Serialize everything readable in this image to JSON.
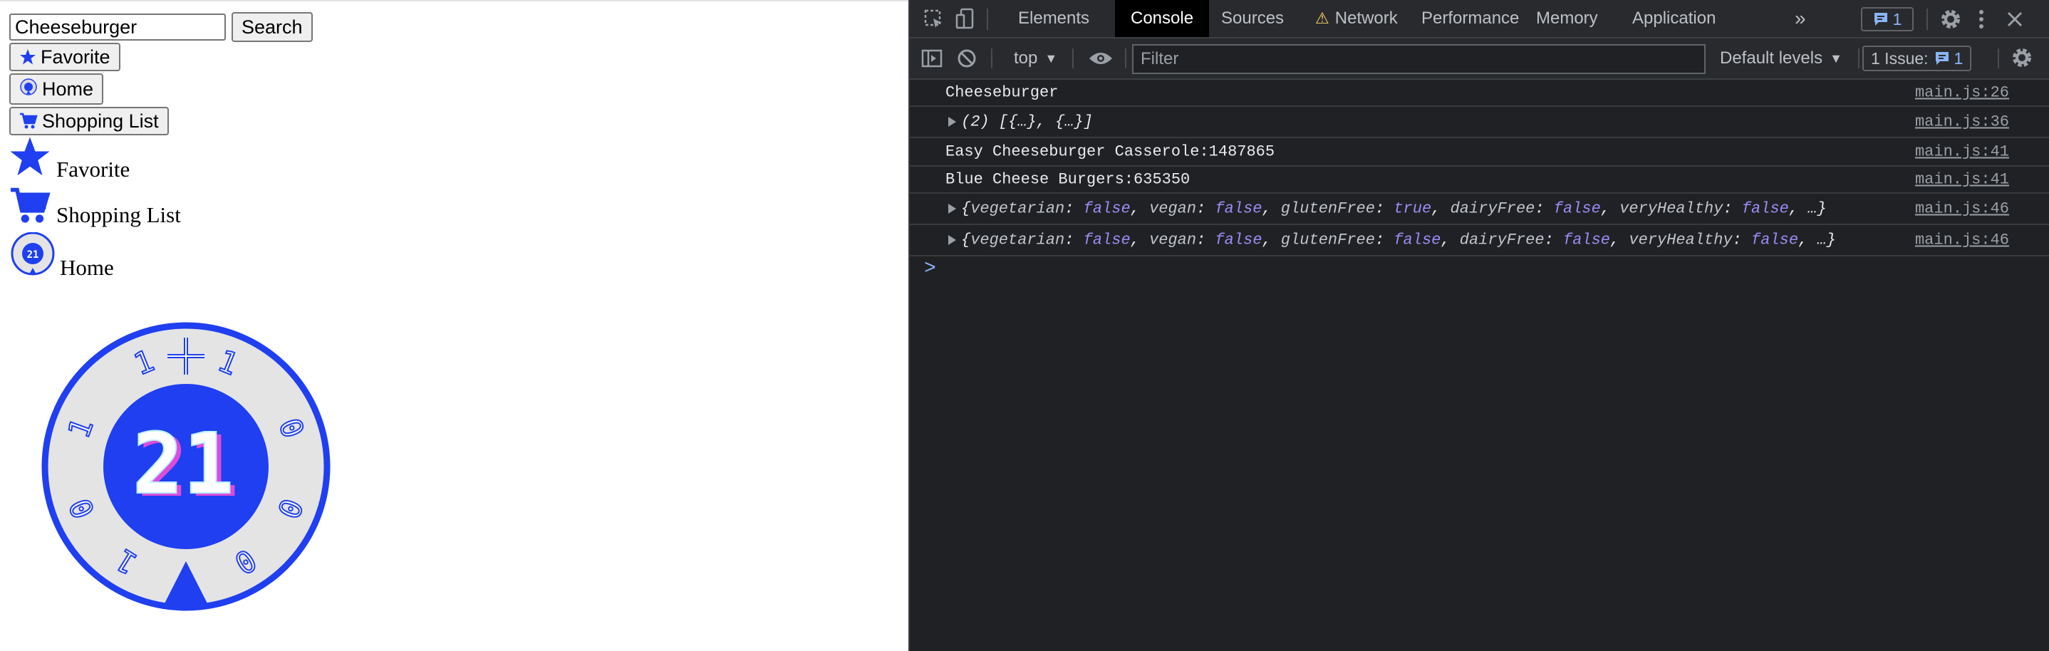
{
  "page": {
    "search": {
      "value": "Cheeseburger",
      "button": "Search"
    },
    "buttons": {
      "favorite": "Favorite",
      "home": "Home",
      "shopping_list": "Shopping List"
    },
    "links": {
      "favorite": "Favorite",
      "shopping_list": "Shopping List",
      "home": "Home"
    },
    "clock": {
      "number": "21",
      "digits": [
        "1",
        "1",
        "0",
        "0",
        "0",
        "1",
        "0",
        "1"
      ]
    },
    "accent_color": "#1f3ff0"
  },
  "devtools": {
    "tabs": [
      "Elements",
      "Console",
      "Sources",
      "Network",
      "Performance",
      "Memory",
      "Application"
    ],
    "active_tab": "Console",
    "more_tabs": "»",
    "message_count": "1",
    "toolbar": {
      "context": "top",
      "filter_placeholder": "Filter",
      "levels": "Default levels",
      "issues_label": "1 Issue:",
      "issues_count": "1"
    },
    "console": [
      {
        "text": "Cheeseburger",
        "source": "main.js:26"
      },
      {
        "text": "(2) [{…}, {…}]",
        "source": "main.js:36",
        "expandable": true
      },
      {
        "text": "Easy Cheeseburger Casserole:1487865",
        "source": "main.js:41"
      },
      {
        "text": "Blue Cheese Burgers:635350",
        "source": "main.js:41"
      },
      {
        "source": "main.js:46",
        "expandable": true,
        "obj": [
          {
            "k": "vegetarian",
            "v": "false"
          },
          {
            "k": "vegan",
            "v": "false"
          },
          {
            "k": "glutenFree",
            "v": "true"
          },
          {
            "k": "dairyFree",
            "v": "false"
          },
          {
            "k": "veryHealthy",
            "v": "false"
          }
        ]
      },
      {
        "source": "main.js:46",
        "expandable": true,
        "obj": [
          {
            "k": "vegetarian",
            "v": "false"
          },
          {
            "k": "vegan",
            "v": "false"
          },
          {
            "k": "glutenFree",
            "v": "false"
          },
          {
            "k": "dairyFree",
            "v": "false"
          },
          {
            "k": "veryHealthy",
            "v": "false"
          }
        ]
      }
    ],
    "prompt": ">"
  }
}
